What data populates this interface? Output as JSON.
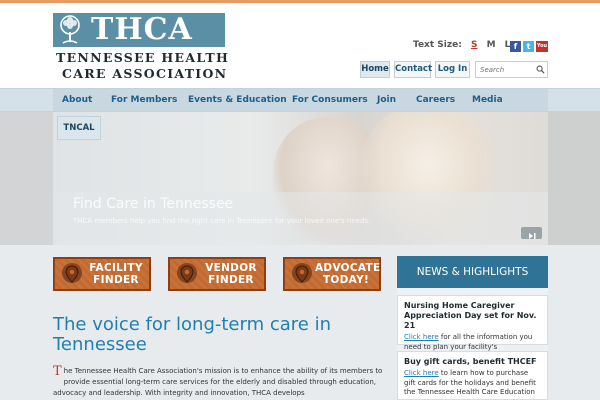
{
  "colors": {
    "brand_blue": "#5b8fa5",
    "link_blue": "#1f7fb3",
    "nav_text": "#1d5f8a",
    "accent_orange": "#c4692f",
    "top_rule": "#e79a62",
    "news_header": "#2f7396"
  },
  "logo": {
    "abbr": "THCA",
    "line1": "Tennessee Health",
    "line2": "Care Association",
    "icon": "tree-icon"
  },
  "text_size": {
    "label": "Text Size:",
    "options": [
      "S",
      "M",
      "L"
    ],
    "selected": "S"
  },
  "social": [
    {
      "icon": "facebook-icon",
      "glyph": "f"
    },
    {
      "icon": "twitter-icon",
      "glyph": "t"
    },
    {
      "icon": "youtube-icon",
      "glyph": "You"
    }
  ],
  "utility": {
    "home": "Home",
    "contact": "Contact",
    "login": "Log In",
    "search_placeholder": "Search"
  },
  "nav": {
    "items": [
      "About",
      "For Members",
      "Events & Education",
      "For Consumers",
      "Join",
      "Careers",
      "Media"
    ]
  },
  "hero": {
    "tab": "TNCAL",
    "title": "Find Care in Tennessee",
    "caption": "THCA members help you find the right care in Tennessee for your loved one's needs."
  },
  "ctas": [
    {
      "line1": "FACILITY",
      "line2": "FINDER",
      "icon": "map-pin-icon"
    },
    {
      "line1": "VENDOR",
      "line2": "FINDER",
      "icon": "map-pin-icon"
    },
    {
      "line1": "ADVOCATE",
      "line2": "TODAY!",
      "icon": "map-pin-icon"
    }
  ],
  "main": {
    "headline": "The voice for long-term care in Tennessee",
    "mission_dropcap": "T",
    "mission_text": "he Tennessee Health Care Association's mission is to enhance the ability of its members to provide essential long-term care services for the elderly and disabled through education, advocacy and leadership. With integrity and innovation, THCA develops"
  },
  "news": {
    "header": "NEWS & HIGHLIGHTS",
    "items": [
      {
        "title": "Nursing Home Caregiver Appreciation Day set for Nov. 21",
        "link": "Click here",
        "body": " for all the information you need to plan your facility's celebration."
      },
      {
        "title": "Buy gift cards, benefit THCEF",
        "link": "Click here",
        "body": " to learn how to purchase gift cards for the holidays and benefit the Tennessee Health Care Education"
      }
    ]
  }
}
